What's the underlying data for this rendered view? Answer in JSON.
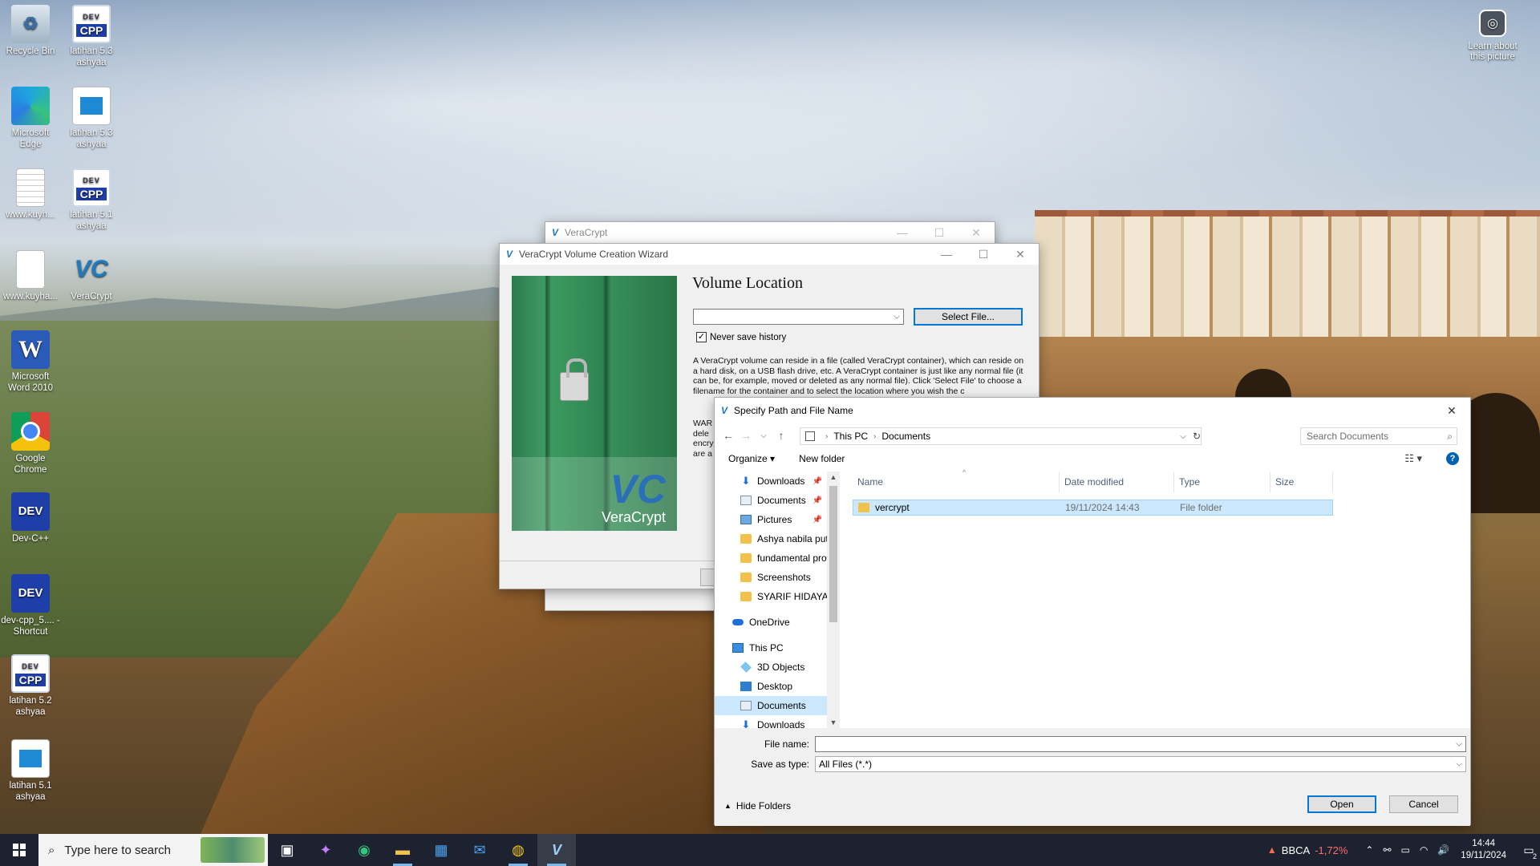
{
  "desktop": {
    "icons": [
      {
        "label": "Recycle Bin"
      },
      {
        "label": "latihan 5.3 ashyaa"
      },
      {
        "label": "Microsoft Edge"
      },
      {
        "label": "latihan 5.3 ashyaa"
      },
      {
        "label": "www.kuyh..."
      },
      {
        "label": "latihan 5.1 ashyaa"
      },
      {
        "label": "www.kuyha..."
      },
      {
        "label": "VeraCrypt"
      },
      {
        "label": "Microsoft Word 2010"
      },
      {
        "label": "Google Chrome"
      },
      {
        "label": "Dev-C++"
      },
      {
        "label": "dev-cpp_5.... - Shortcut"
      },
      {
        "label": "latihan 5.2 ashyaa"
      },
      {
        "label": "latihan 5.1 ashyaa"
      }
    ],
    "icon_text": {
      "cpp": "CPP",
      "dev": "DEV",
      "vc": "VC",
      "word": "W"
    },
    "learn_label": "Learn about this picture"
  },
  "vc_main": {
    "title": "VeraCrypt"
  },
  "wizard": {
    "title": "VeraCrypt Volume Creation Wizard",
    "heading": "Volume Location",
    "combo_value": "",
    "select_file_label": "Select File...",
    "never_save_history_label": "Never save history",
    "never_save_history_checked": true,
    "description": "A VeraCrypt volume can reside in a file (called VeraCrypt container), which can reside on a hard disk, on a USB flash drive, etc. A VeraCrypt container is just like any normal file (it can be, for example, moved or deleted as any normal file). Click 'Select File' to choose a filename for the container and to select the location where you wish the c",
    "warning_partial": "WAR dele encry are a",
    "logo_text": "VeraCrypt"
  },
  "dialog": {
    "title": "Specify Path and File Name",
    "address": [
      "This PC",
      "Documents"
    ],
    "search_placeholder": "Search Documents",
    "organize_label": "Organize ▾",
    "new_folder_label": "New folder",
    "help_label": "?",
    "tree": [
      {
        "label": "Downloads",
        "icon": "down",
        "pinned": true
      },
      {
        "label": "Documents",
        "icon": "docs",
        "pinned": true
      },
      {
        "label": "Pictures",
        "icon": "pics",
        "pinned": true
      },
      {
        "label": "Ashya nabila put",
        "icon": "folder",
        "pinned": false
      },
      {
        "label": "fundamental pro",
        "icon": "folder",
        "pinned": false
      },
      {
        "label": "Screenshots",
        "icon": "folder",
        "pinned": false
      },
      {
        "label": "SYARIF HIDAYAH",
        "icon": "folder",
        "pinned": false
      },
      {
        "label": "OneDrive",
        "icon": "cloud",
        "pinned": false
      },
      {
        "label": "This PC",
        "icon": "pc",
        "pinned": false
      },
      {
        "label": "3D Objects",
        "icon": "cube",
        "pinned": false
      },
      {
        "label": "Desktop",
        "icon": "desk",
        "pinned": false
      },
      {
        "label": "Documents",
        "icon": "docs",
        "pinned": false
      },
      {
        "label": "Downloads",
        "icon": "down",
        "pinned": false
      }
    ],
    "columns": {
      "name": "Name",
      "date": "Date modified",
      "type": "Type",
      "size": "Size"
    },
    "files": [
      {
        "name": "vercrypt",
        "date": "19/11/2024 14:43",
        "type": "File folder",
        "size": ""
      }
    ],
    "file_name_label": "File name:",
    "file_name_value": "",
    "save_as_type_label": "Save as type:",
    "save_as_type_value": "All Files (*.*)",
    "hide_folders_label": "Hide Folders",
    "open_label": "Open",
    "cancel_label": "Cancel"
  },
  "taskbar": {
    "search_placeholder": "Type here to search",
    "stock_name": "BBCA",
    "stock_change": "-1,72%",
    "time": "14:44",
    "date": "19/11/2024",
    "notification_count": "2"
  },
  "colors": {
    "accent": "#0078d7",
    "selection": "#cce8ff",
    "taskbar": "#1c2230",
    "stock_negative": "#ff6b6b"
  }
}
